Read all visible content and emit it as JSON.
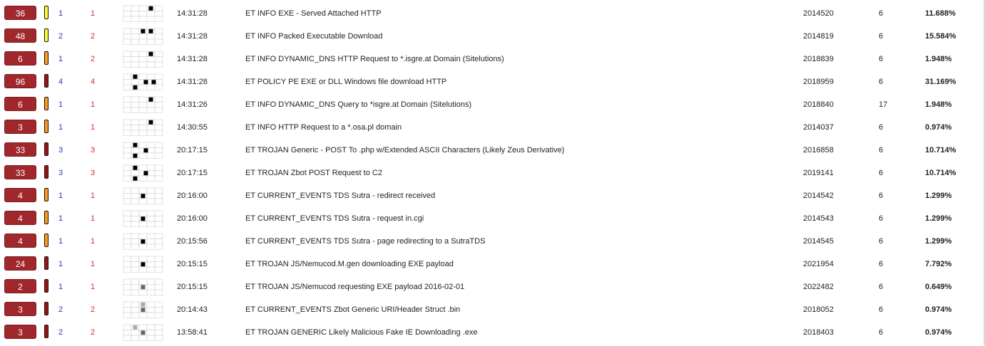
{
  "rows": [
    {
      "count": "36",
      "priority": "yellow",
      "src": "1",
      "dst": "1",
      "grid": [
        [
          0,
          0,
          0,
          0,
          0
        ],
        [
          0,
          0,
          0,
          1,
          0
        ],
        [
          0,
          0,
          0,
          0,
          0
        ]
      ],
      "time": "14:31:28",
      "signature": "ET INFO EXE - Served Attached HTTP",
      "sid": "2014520",
      "rev": "6",
      "percent": "11.688%"
    },
    {
      "count": "48",
      "priority": "yellow",
      "src": "2",
      "dst": "2",
      "grid": [
        [
          0,
          0,
          0,
          0,
          0
        ],
        [
          0,
          0,
          1,
          1,
          0
        ],
        [
          0,
          0,
          0,
          0,
          0
        ]
      ],
      "time": "14:31:28",
      "signature": "ET INFO Packed Executable Download",
      "sid": "2014819",
      "rev": "6",
      "percent": "15.584%"
    },
    {
      "count": "6",
      "priority": "orange",
      "src": "1",
      "dst": "2",
      "grid": [
        [
          0,
          0,
          0,
          0,
          0
        ],
        [
          0,
          0,
          0,
          1,
          0
        ],
        [
          0,
          0,
          0,
          0,
          0
        ]
      ],
      "time": "14:31:28",
      "signature": "ET INFO DYNAMIC_DNS HTTP Request to *.isgre.at Domain (Sitelutions)",
      "sid": "2018839",
      "rev": "6",
      "percent": "1.948%"
    },
    {
      "count": "96",
      "priority": "red",
      "src": "4",
      "dst": "4",
      "grid": [
        [
          0,
          0,
          0,
          0,
          0
        ],
        [
          0,
          1,
          0,
          0,
          0
        ],
        [
          0,
          0,
          1,
          1,
          0
        ],
        [
          0,
          1,
          0,
          0,
          0
        ]
      ],
      "time": "14:31:28",
      "signature": "ET POLICY PE EXE or DLL Windows file download HTTP",
      "sid": "2018959",
      "rev": "6",
      "percent": "31.169%"
    },
    {
      "count": "6",
      "priority": "orange",
      "src": "1",
      "dst": "1",
      "grid": [
        [
          0,
          0,
          0,
          0,
          0
        ],
        [
          0,
          0,
          0,
          1,
          0
        ],
        [
          0,
          0,
          0,
          0,
          0
        ]
      ],
      "time": "14:31:26",
      "signature": "ET INFO DYNAMIC_DNS Query to *isgre.at Domain (Sitelutions)",
      "sid": "2018840",
      "rev": "17",
      "percent": "1.948%"
    },
    {
      "count": "3",
      "priority": "orange",
      "src": "1",
      "dst": "1",
      "grid": [
        [
          0,
          0,
          0,
          0,
          0
        ],
        [
          0,
          0,
          0,
          1,
          0
        ],
        [
          0,
          0,
          0,
          0,
          0
        ]
      ],
      "time": "14:30:55",
      "signature": "ET INFO HTTP Request to a *.osa.pl domain",
      "sid": "2014037",
      "rev": "6",
      "percent": "0.974%"
    },
    {
      "count": "33",
      "priority": "red",
      "src": "3",
      "dst": "3",
      "grid": [
        [
          0,
          0,
          0,
          0,
          0
        ],
        [
          0,
          1,
          0,
          0,
          0
        ],
        [
          0,
          0,
          1,
          0,
          0
        ],
        [
          0,
          1,
          0,
          0,
          0
        ]
      ],
      "time": "20:17:15",
      "signature": "ET TROJAN Generic - POST To .php w/Extended ASCII Characters (Likely Zeus Derivative)",
      "sid": "2016858",
      "rev": "6",
      "percent": "10.714%"
    },
    {
      "count": "33",
      "priority": "red",
      "src": "3",
      "dst": "3",
      "grid": [
        [
          0,
          0,
          0,
          0,
          0
        ],
        [
          0,
          1,
          0,
          0,
          0
        ],
        [
          0,
          0,
          1,
          0,
          0
        ],
        [
          0,
          1,
          0,
          0,
          0
        ]
      ],
      "time": "20:17:15",
      "signature": "ET TROJAN Zbot POST Request to C2",
      "sid": "2019141",
      "rev": "6",
      "percent": "10.714%"
    },
    {
      "count": "4",
      "priority": "orange",
      "src": "1",
      "dst": "1",
      "grid": [
        [
          0,
          0,
          0,
          0,
          0
        ],
        [
          0,
          0,
          0,
          0,
          0
        ],
        [
          0,
          0,
          1,
          0,
          0
        ]
      ],
      "time": "20:16:00",
      "signature": "ET CURRENT_EVENTS TDS Sutra - redirect received",
      "sid": "2014542",
      "rev": "6",
      "percent": "1.299%"
    },
    {
      "count": "4",
      "priority": "orange",
      "src": "1",
      "dst": "1",
      "grid": [
        [
          0,
          0,
          0,
          0,
          0
        ],
        [
          0,
          0,
          0,
          0,
          0
        ],
        [
          0,
          0,
          1,
          0,
          0
        ]
      ],
      "time": "20:16:00",
      "signature": "ET CURRENT_EVENTS TDS Sutra - request in.cgi",
      "sid": "2014543",
      "rev": "6",
      "percent": "1.299%"
    },
    {
      "count": "4",
      "priority": "orange",
      "src": "1",
      "dst": "1",
      "grid": [
        [
          0,
          0,
          0,
          0,
          0
        ],
        [
          0,
          0,
          0,
          0,
          0
        ],
        [
          0,
          0,
          1,
          0,
          0
        ]
      ],
      "time": "20:15:56",
      "signature": "ET CURRENT_EVENTS TDS Sutra - page redirecting to a SutraTDS",
      "sid": "2014545",
      "rev": "6",
      "percent": "1.299%"
    },
    {
      "count": "24",
      "priority": "red",
      "src": "1",
      "dst": "1",
      "grid": [
        [
          0,
          0,
          0,
          0,
          0
        ],
        [
          0,
          0,
          0,
          0,
          0
        ],
        [
          0,
          0,
          1,
          0,
          0
        ]
      ],
      "time": "20:15:15",
      "signature": "ET TROJAN JS/Nemucod.M.gen downloading EXE payload",
      "sid": "2021954",
      "rev": "6",
      "percent": "7.792%"
    },
    {
      "count": "2",
      "priority": "red",
      "src": "1",
      "dst": "1",
      "grid": [
        [
          0,
          0,
          0,
          0,
          0
        ],
        [
          0,
          0,
          0,
          0,
          0
        ],
        [
          0,
          0,
          2,
          0,
          0
        ]
      ],
      "time": "20:15:15",
      "signature": "ET TROJAN JS/Nemucod requesting EXE payload 2016-02-01",
      "sid": "2022482",
      "rev": "6",
      "percent": "0.649%"
    },
    {
      "count": "3",
      "priority": "red",
      "src": "2",
      "dst": "2",
      "grid": [
        [
          0,
          0,
          0,
          0,
          0
        ],
        [
          0,
          0,
          3,
          0,
          0
        ],
        [
          0,
          0,
          2,
          0,
          0
        ]
      ],
      "time": "20:14:43",
      "signature": "ET CURRENT_EVENTS Zbot Generic URI/Header Struct .bin",
      "sid": "2018052",
      "rev": "6",
      "percent": "0.974%"
    },
    {
      "count": "3",
      "priority": "red",
      "src": "2",
      "dst": "2",
      "grid": [
        [
          0,
          0,
          0,
          0,
          0
        ],
        [
          0,
          3,
          0,
          0,
          0
        ],
        [
          0,
          0,
          2,
          0,
          0
        ]
      ],
      "time": "13:58:41",
      "signature": "ET TROJAN GENERIC Likely Malicious Fake IE Downloading .exe",
      "sid": "2018403",
      "rev": "6",
      "percent": "0.974%"
    }
  ],
  "colors": {
    "count_bg": "#a0272c",
    "src_link": "#1a3cc8",
    "dst_link": "#e02828",
    "priority_yellow": "#ffff33",
    "priority_orange": "#ff9922",
    "priority_red": "#9a1414",
    "cell_black": "#000000",
    "cell_dark_gray": "#666666",
    "cell_light_gray": "#aaaaaa"
  }
}
